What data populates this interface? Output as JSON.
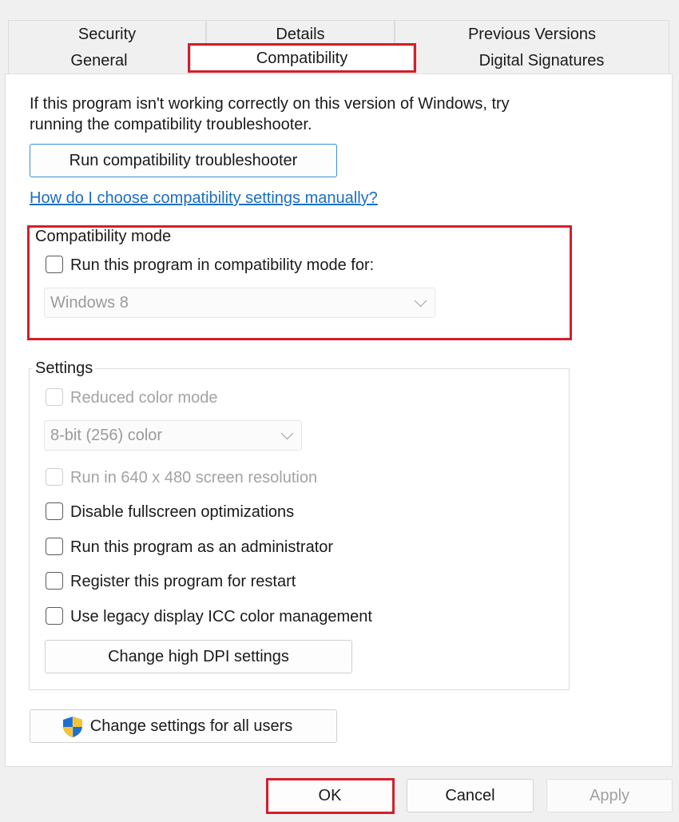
{
  "tabs": {
    "row1": [
      "Security",
      "Details",
      "Previous Versions"
    ],
    "row2": [
      "General",
      "Compatibility",
      "Digital Signatures"
    ]
  },
  "intro": {
    "line1": "If this program isn't working correctly on this version of Windows, try",
    "line2": "running the compatibility troubleshooter."
  },
  "troubleshooter_button": "Run compatibility troubleshooter",
  "manual_link": "How do I choose compatibility settings manually?",
  "compat_mode": {
    "legend": "Compatibility mode",
    "checkbox_label": "Run this program in compatibility mode for:",
    "checked": false,
    "os_selected": "Windows 8"
  },
  "settings": {
    "legend": "Settings",
    "reduced_color": "Reduced color mode",
    "color_selected": "8-bit (256) color",
    "run_640": "Run in 640 x 480 screen resolution",
    "disable_fullscreen": "Disable fullscreen optimizations",
    "run_admin": "Run this program as an administrator",
    "register_restart": "Register this program for restart",
    "legacy_icc": "Use legacy display ICC color management",
    "high_dpi_button": "Change high DPI settings"
  },
  "all_users_button": "Change settings for all users",
  "footer": {
    "ok": "OK",
    "cancel": "Cancel",
    "apply": "Apply"
  },
  "colors": {
    "highlight": "#d31f2b",
    "link": "#1b6ec2"
  }
}
